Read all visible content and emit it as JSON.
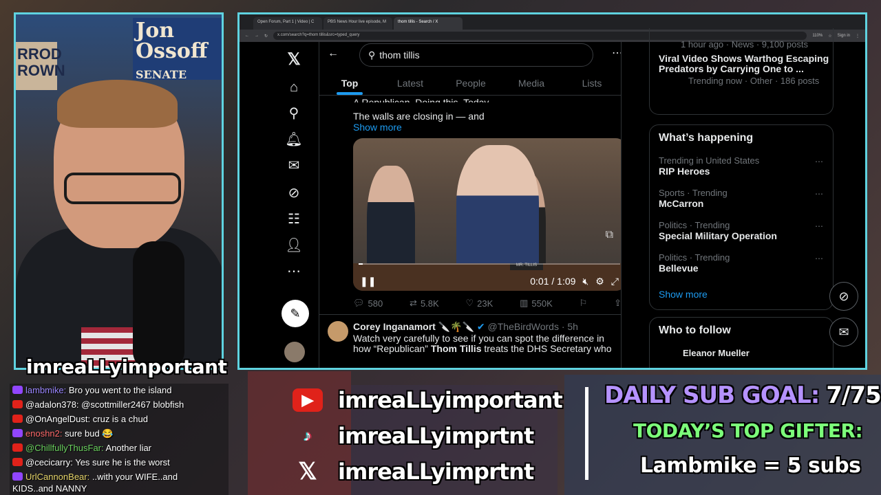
{
  "webcam": {
    "sign_text": "Jon Ossoff",
    "sign_sub": "SENATE",
    "sign_left": "RROD ROWN",
    "streamer_name": "imreaLLyimportant"
  },
  "browser": {
    "tabs": [
      "Open Forum, Part 1 | Video | C",
      "PBS News Hour live episode, M",
      "thom tillis - Search / X"
    ],
    "url": "x.com/search?q=thom tillis&src=typed_query",
    "zoom": "110%",
    "signin": "Sign in"
  },
  "x": {
    "search_value": "thom tillis",
    "tabs": [
      "Top",
      "Latest",
      "People",
      "Media",
      "Lists"
    ],
    "tweet1": {
      "partial_line": "A Republican. Doing this. Today.",
      "text": "The walls are closing in — and",
      "show_more": "Show more",
      "video": {
        "nameplate": "MR. TILLIS",
        "time": "0:01 / 1:09",
        "progress": 0.015
      },
      "replies": "580",
      "reposts": "5.8K",
      "likes": "23K",
      "views": "550K"
    },
    "tweet2": {
      "name": "Corey Inganamort",
      "emoji": "🔪🌴🔪",
      "handle": "@TheBirdWords · 5h",
      "text_prefix": "Watch very carefully to see if you can spot the difference in how “Republican”",
      "text_bold": "Thom Tillis",
      "text_suffix": "treats the DHS Secretary who"
    }
  },
  "sidebar": {
    "top_meta": "1 hour ago · News · 9,100 posts",
    "story_title": "Viral Video Shows Warthog Escaping Predators by Carrying One to ...",
    "story_meta": "Trending now · Other · 186 posts",
    "whats_happening": "What’s happening",
    "trends": [
      {
        "category": "Trending in United States",
        "name": "RIP Heroes"
      },
      {
        "category": "Sports · Trending",
        "name": "McCarron"
      },
      {
        "category": "Politics · Trending",
        "name": "Special Military Operation"
      },
      {
        "category": "Politics · Trending",
        "name": "Bellevue"
      }
    ],
    "show_more": "Show more",
    "who_to_follow": "Who to follow",
    "follow_partial": "Eleanor Mueller"
  },
  "chat": [
    {
      "platform": "twitch",
      "user": "lambmike:",
      "text": "Bro you went to the island"
    },
    {
      "platform": "youtube",
      "user": "@adalon378:",
      "text": "@scottmiller2467 blobfish"
    },
    {
      "platform": "youtube",
      "user": "@OnAngelDust:",
      "text": "cruz is a chud"
    },
    {
      "platform": "twitch",
      "user": "enoshn2:",
      "text": "sure bud 😂"
    },
    {
      "platform": "youtube",
      "user": "@ChillfullyThusFar:",
      "text": "Another liar"
    },
    {
      "platform": "youtube",
      "user": "@cecicarry:",
      "text": "Yes sure he is the worst"
    },
    {
      "platform": "twitch",
      "user": "UrlCannonBear:",
      "text": "..with your WIFE..and"
    },
    {
      "platform": "none",
      "user": "",
      "text": "KIDS..and NANNY"
    }
  ],
  "socials": {
    "youtube": "imreaLLyimportant",
    "tiktok": "imreaLLyimprtnt",
    "x": "imreaLLyimprtnt"
  },
  "goal": {
    "label": "DAILY SUB GOAL:",
    "value": "7/75",
    "gifter_label": "TODAY’S TOP GIFTER:",
    "gifter": "Lambmike = 5 subs"
  },
  "colors": {
    "accent": "#1d9bf0",
    "frame": "#5fd3e0",
    "goal": "#b592ff",
    "gifter": "#7cff7a"
  },
  "icons": [
    "x-logo-icon",
    "home-icon",
    "search-icon",
    "bell-icon",
    "mail-icon",
    "grok-icon",
    "list-icon",
    "profile-icon",
    "more-circle-icon",
    "compose-icon"
  ]
}
